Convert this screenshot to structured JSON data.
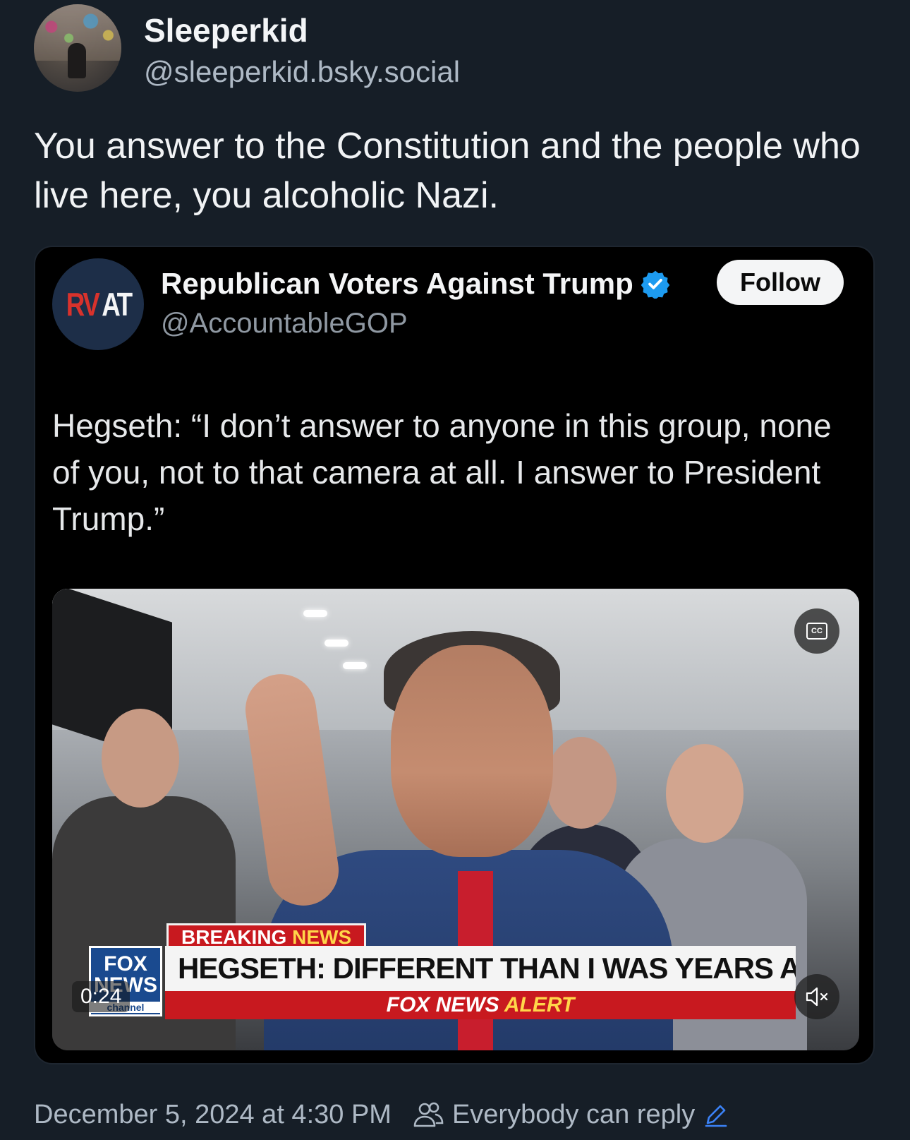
{
  "author": {
    "display_name": "Sleeperkid",
    "handle": "@sleeperkid.bsky.social"
  },
  "post": {
    "text": "You answer to the Constitution and the people who live here, you alcoholic Nazi."
  },
  "embed": {
    "avatar_text_rv": "RV",
    "avatar_text_at": "AT",
    "display_name": "Republican Voters Against Trump",
    "verified_icon": "verified-badge-icon",
    "handle": "@AccountableGOP",
    "follow_label": "Follow",
    "text": "Hegseth: “I don’t answer to anyone in this group, none of you, not to that camera at all. I answer to President Trump.”",
    "video": {
      "breaking_label": "BREAKING",
      "breaking_news": "NEWS",
      "fox_logo_top": "FOX",
      "fox_logo_mid": "NEWS",
      "fox_logo_channel": "channel",
      "headline": "HEGSETH: DIFFERENT THAN I WAS YEARS AGO",
      "alert_fox": "FOX NEWS",
      "alert_word": "ALERT",
      "timestamp": "0:24",
      "cc_label": "CC"
    }
  },
  "footer": {
    "date": "December 5, 2024 at 4:30 PM",
    "reply_setting": "Everybody can reply"
  },
  "colors": {
    "background": "#161e27",
    "embed_background": "#000000",
    "fox_red": "#c8191f",
    "verified_blue": "#1d9bf0",
    "muted_text": "#aeb9c5",
    "accent_blue": "#3b82f6"
  }
}
